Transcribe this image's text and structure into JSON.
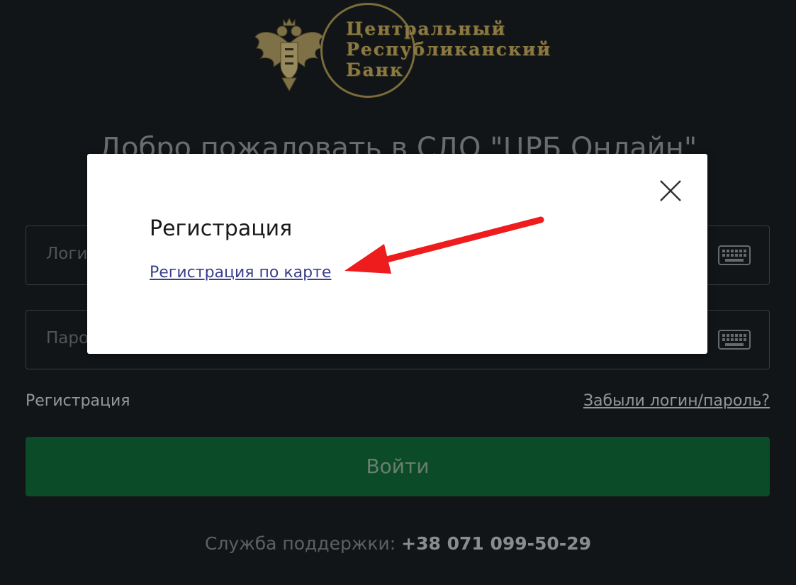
{
  "logo": {
    "lines": [
      "Центральный",
      "Республиканский",
      "Банк"
    ],
    "gold": "#b8a25a"
  },
  "welcome": {
    "title": "Добро пожаловать в СДО \"ЦРБ Онлайн\""
  },
  "login_form": {
    "login_placeholder": "Логин",
    "password_placeholder": "Пароль",
    "keyboard_icon": "keyboard-icon",
    "registration_label": "Регистрация",
    "forgot_label": "Забыли логин/пароль?",
    "enter_label": "Войти",
    "enter_color": "#0f6535"
  },
  "support": {
    "label": "Служба поддержки:",
    "phone": "+38 071 099-50-29"
  },
  "modal": {
    "title": "Регистрация",
    "card_link": "Регистрация по карте",
    "close_icon": "close-icon"
  },
  "annotation": {
    "arrow_color": "#ee1c1c"
  }
}
